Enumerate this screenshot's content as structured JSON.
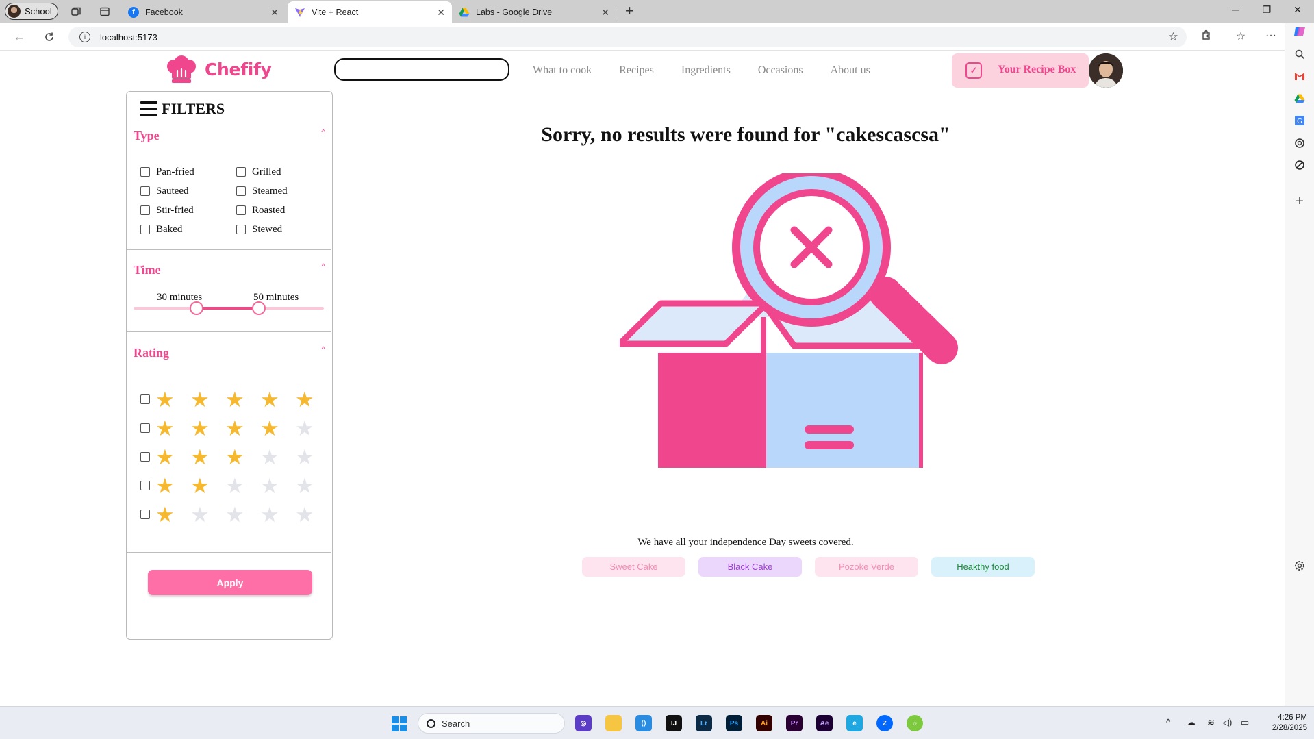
{
  "browser": {
    "profile": "School",
    "tabs": [
      {
        "title": "Facebook",
        "icon": "facebook-icon"
      },
      {
        "title": "Vite + React",
        "icon": "vite-icon"
      },
      {
        "title": "Labs - Google Drive",
        "icon": "google-drive-icon"
      }
    ],
    "url": "localhost:5173"
  },
  "header": {
    "logo_text": "Chefify",
    "search_value": "",
    "nav": [
      "What to cook",
      "Recipes",
      "Ingredients",
      "Occasions",
      "About us"
    ],
    "recipe_box_label": "Your Recipe Box"
  },
  "filters": {
    "title": "FILTERS",
    "type": {
      "title": "Type",
      "options": [
        "Pan-fried",
        "Grilled",
        "Sauteed",
        "Steamed",
        "Stir-fried",
        "Roasted",
        "Baked",
        "Stewed"
      ]
    },
    "time": {
      "title": "Time",
      "min_label": "30 minutes",
      "max_label": "50 minutes",
      "range_fraction": [
        0.33,
        0.66
      ]
    },
    "rating": {
      "title": "Rating",
      "rows": [
        5,
        4,
        3,
        2,
        1
      ]
    },
    "apply_label": "Apply"
  },
  "results": {
    "message": "Sorry, no results were found for \"cakescascsa\"",
    "subtext": "We have all your independence Day sweets covered.",
    "chips": [
      {
        "label": "Sweet Cake",
        "bg": "#fde4ee",
        "color": "#f58bb4"
      },
      {
        "label": "Black Cake",
        "bg": "#ead7fb",
        "color": "#9d3fd6"
      },
      {
        "label": "Pozoke Verde",
        "bg": "#fde4ee",
        "color": "#f58bb4"
      },
      {
        "label": "Heakthy food",
        "bg": "#d8f1fb",
        "color": "#1d8a3a"
      }
    ]
  },
  "taskbar": {
    "search_label": "Search",
    "time": "4:26 PM",
    "date": "2/28/2025"
  },
  "colors": {
    "brand": "#f0468d",
    "apply": "#ff6fa7",
    "star_on": "#f5b82e",
    "star_off": "#e3e4ea"
  }
}
